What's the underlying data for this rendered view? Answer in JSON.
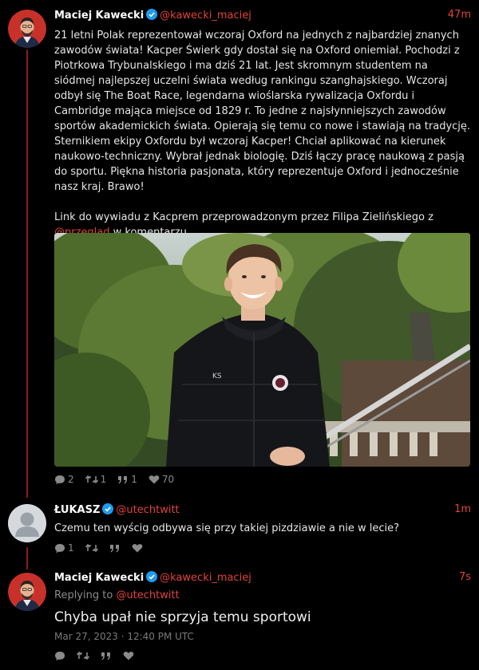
{
  "colors": {
    "accent": "#e0443b",
    "thread_line": "#8b1a1a",
    "background": "#000000"
  },
  "tweets": [
    {
      "name": "Maciej Kawecki",
      "handle": "@kawecki_maciej",
      "time": "47m",
      "lines": [
        "21 letni Polak reprezentował wczoraj Oxford na jednych z najbardziej znanych",
        "zawodów świata! Kacper Świerk gdy dostał się na Oxford oniemiał. Pochodzi z",
        "Piotrkowa Trybunalskiego i ma dziś 21 lat. Jest skromnym studentem na",
        "siódmej najlepszej uczelni świata według rankingu szanghajskiego. Wczoraj",
        "odbył się The Boat Race, legendarna wioślarska rywalizacja Oxfordu i",
        "Cambridge mająca miejsce od 1829 r. To jedne z najsłynniejszych zawodów",
        "sportów akademickich świata. Opierają się temu co nowe i stawiają na tradycję.",
        "Sternikiem ekipy Oxfordu był wczoraj Kacper! Chciał aplikować na kierunek",
        "naukowo-techniczny. Wybrał jednak biologię. Dziś łączy pracę naukową z pasją",
        "do sportu. Piękna historia pasjonata, który reprezentuje Oxford i jednocześnie",
        "nasz kraj. Brawo!"
      ],
      "link_line": "Link do wywiadu z Kacprem przeprowadzonym przez Filipa Zielińskiego z",
      "mention": "@przeglad",
      "mention_suffix": " w komentarzu.",
      "photo_text": "KS",
      "reply_count": "2",
      "retweet_count": "1",
      "quote_count": "1",
      "like_count": "70"
    },
    {
      "name": "ŁUKASZ",
      "handle": "@utechtwitt",
      "time": "1m",
      "text": "Czemu ten wyścig odbywa się przy takiej pizdziawie a nie w lecie?",
      "reply_count": "1"
    },
    {
      "name": "Maciej Kawecki",
      "handle": "@kawecki_maciej",
      "time": "7s",
      "replying_prefix": "Replying to ",
      "replying_to": "@utechtwitt",
      "text": "Chyba upał nie sprzyja temu sportowi",
      "timestamp": "Mar 27, 2023 · 12:40 PM UTC"
    }
  ]
}
